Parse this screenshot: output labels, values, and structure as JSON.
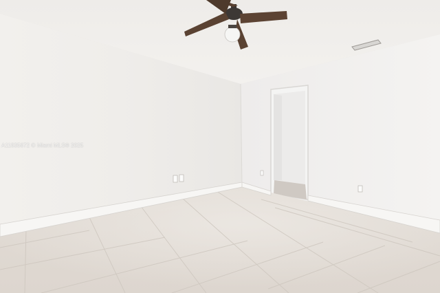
{
  "photo": {
    "watermark": "A11835672 © Miami MLS® 2025"
  }
}
